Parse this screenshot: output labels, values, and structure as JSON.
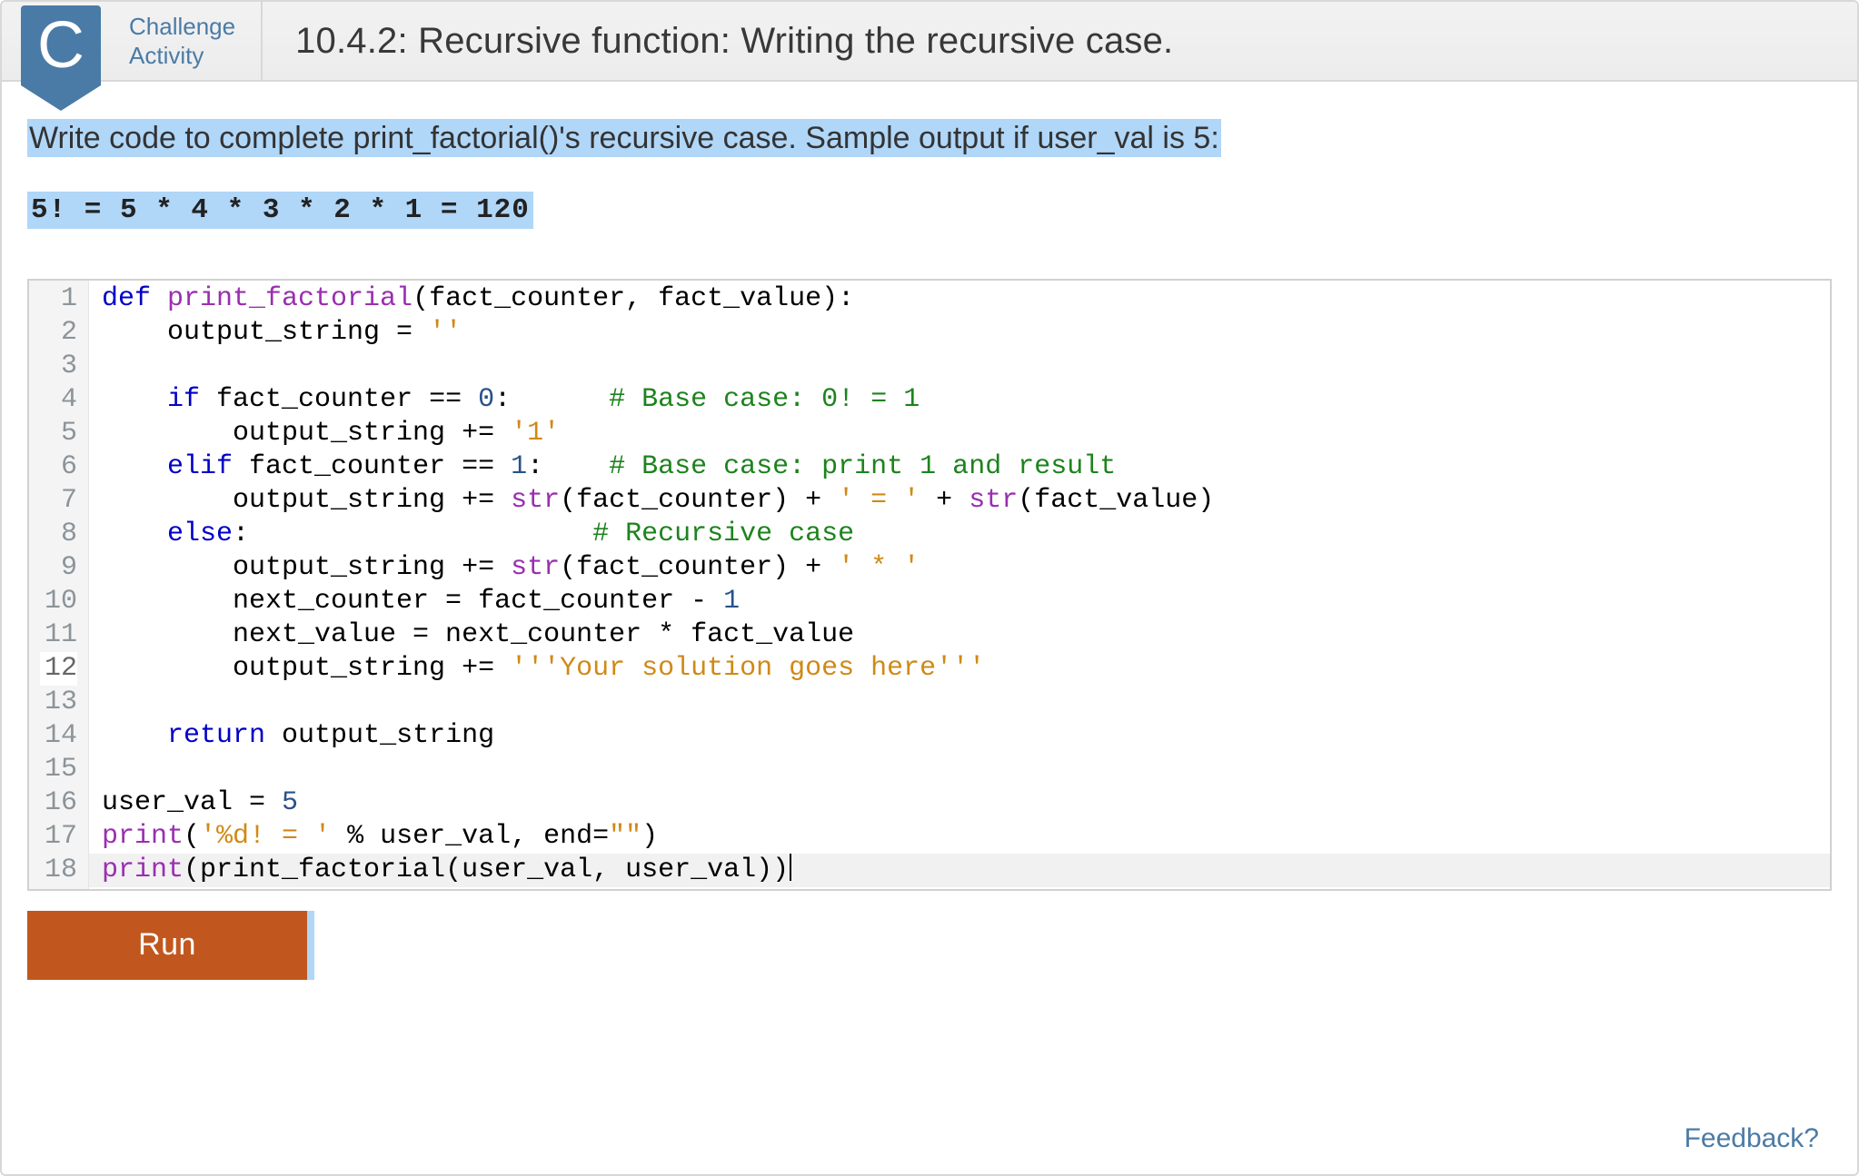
{
  "header": {
    "badge_letter": "C",
    "label_line1": "Challenge",
    "label_line2": "Activity",
    "title": "10.4.2: Recursive function: Writing the recursive case."
  },
  "prompt": "Write code to complete print_factorial()'s recursive case. Sample output if user_val is 5:",
  "sample_output": "5! = 5 * 4 * 3 * 2 * 1 = 120",
  "code": {
    "total_lines": 18,
    "active_line": 12,
    "lines": [
      {
        "n": 1,
        "segments": [
          {
            "t": "def ",
            "c": "kw"
          },
          {
            "t": "print_factorial",
            "c": "fn"
          },
          {
            "t": "(fact_counter, fact_value):",
            "c": ""
          }
        ]
      },
      {
        "n": 2,
        "segments": [
          {
            "t": "    output_string = ",
            "c": ""
          },
          {
            "t": "''",
            "c": "str"
          }
        ]
      },
      {
        "n": 3,
        "segments": [
          {
            "t": "",
            "c": ""
          }
        ]
      },
      {
        "n": 4,
        "segments": [
          {
            "t": "    ",
            "c": ""
          },
          {
            "t": "if",
            "c": "kw"
          },
          {
            "t": " fact_counter == ",
            "c": ""
          },
          {
            "t": "0",
            "c": "num"
          },
          {
            "t": ":      ",
            "c": ""
          },
          {
            "t": "# Base case: 0! = 1",
            "c": "com"
          }
        ]
      },
      {
        "n": 5,
        "segments": [
          {
            "t": "        output_string += ",
            "c": ""
          },
          {
            "t": "'1'",
            "c": "str"
          }
        ]
      },
      {
        "n": 6,
        "segments": [
          {
            "t": "    ",
            "c": ""
          },
          {
            "t": "elif",
            "c": "kw"
          },
          {
            "t": " fact_counter == ",
            "c": ""
          },
          {
            "t": "1",
            "c": "num"
          },
          {
            "t": ":    ",
            "c": ""
          },
          {
            "t": "# Base case: print 1 and result",
            "c": "com"
          }
        ]
      },
      {
        "n": 7,
        "segments": [
          {
            "t": "        output_string += ",
            "c": ""
          },
          {
            "t": "str",
            "c": "fn"
          },
          {
            "t": "(fact_counter) + ",
            "c": ""
          },
          {
            "t": "' = '",
            "c": "str"
          },
          {
            "t": " + ",
            "c": ""
          },
          {
            "t": "str",
            "c": "fn"
          },
          {
            "t": "(fact_value)",
            "c": ""
          }
        ]
      },
      {
        "n": 8,
        "segments": [
          {
            "t": "    ",
            "c": ""
          },
          {
            "t": "else",
            "c": "kw"
          },
          {
            "t": ":                     ",
            "c": ""
          },
          {
            "t": "# Recursive case",
            "c": "com"
          }
        ]
      },
      {
        "n": 9,
        "segments": [
          {
            "t": "        output_string += ",
            "c": ""
          },
          {
            "t": "str",
            "c": "fn"
          },
          {
            "t": "(fact_counter) + ",
            "c": ""
          },
          {
            "t": "' * '",
            "c": "str"
          }
        ]
      },
      {
        "n": 10,
        "segments": [
          {
            "t": "        next_counter = fact_counter - ",
            "c": ""
          },
          {
            "t": "1",
            "c": "num"
          }
        ]
      },
      {
        "n": 11,
        "segments": [
          {
            "t": "        next_value = next_counter * fact_value",
            "c": ""
          }
        ]
      },
      {
        "n": 12,
        "segments": [
          {
            "t": "        output_string += ",
            "c": ""
          },
          {
            "t": "'''Your solution goes here'''",
            "c": "str"
          }
        ]
      },
      {
        "n": 13,
        "segments": [
          {
            "t": "",
            "c": ""
          }
        ]
      },
      {
        "n": 14,
        "segments": [
          {
            "t": "    ",
            "c": ""
          },
          {
            "t": "return",
            "c": "kw"
          },
          {
            "t": " output_string",
            "c": ""
          }
        ]
      },
      {
        "n": 15,
        "segments": [
          {
            "t": "",
            "c": ""
          }
        ]
      },
      {
        "n": 16,
        "segments": [
          {
            "t": "user_val = ",
            "c": ""
          },
          {
            "t": "5",
            "c": "num"
          }
        ]
      },
      {
        "n": 17,
        "segments": [
          {
            "t": "print",
            "c": "fn"
          },
          {
            "t": "(",
            "c": ""
          },
          {
            "t": "'%d! = '",
            "c": "str"
          },
          {
            "t": " % user_val, end=",
            "c": ""
          },
          {
            "t": "\"\"",
            "c": "str"
          },
          {
            "t": ")",
            "c": ""
          }
        ]
      },
      {
        "n": 18,
        "segments": [
          {
            "t": "print",
            "c": "fn"
          },
          {
            "t": "(print_factorial(user_val, user_val))",
            "c": ""
          }
        ]
      }
    ]
  },
  "run_button": "Run",
  "feedback_link": "Feedback?"
}
